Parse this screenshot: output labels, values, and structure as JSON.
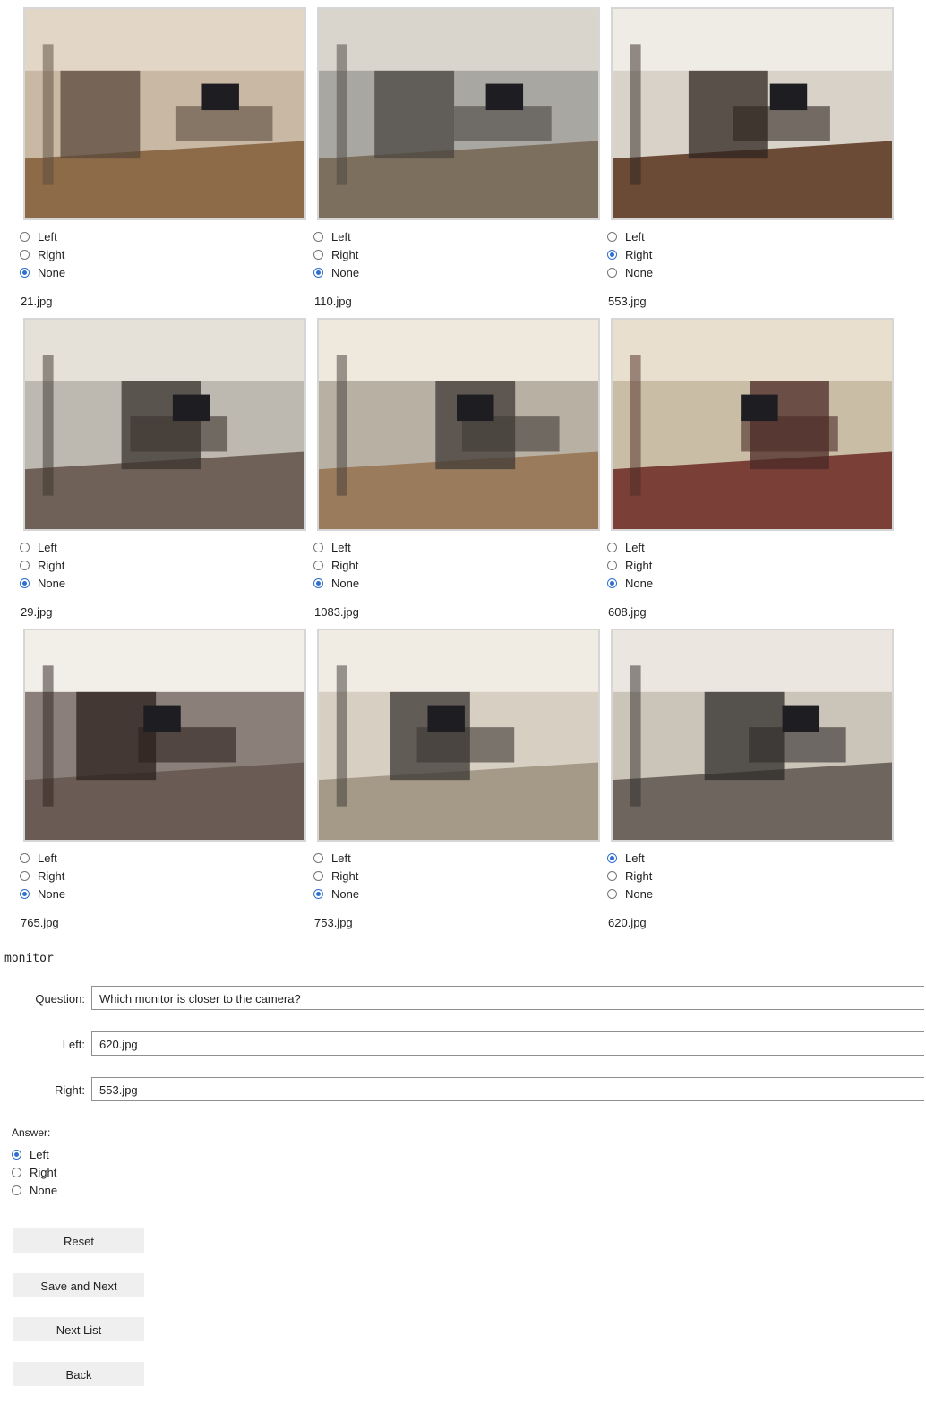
{
  "grid": [
    {
      "file": "21.jpg",
      "icon": "office-photo",
      "selected": "None",
      "options": [
        "Left",
        "Right",
        "None"
      ]
    },
    {
      "file": "110.jpg",
      "icon": "library-photo",
      "selected": "None",
      "options": [
        "Left",
        "Right",
        "None"
      ]
    },
    {
      "file": "553.jpg",
      "icon": "office-desk-photo",
      "selected": "Right",
      "options": [
        "Left",
        "Right",
        "None"
      ]
    },
    {
      "file": "29.jpg",
      "icon": "office-room-photo",
      "selected": "None",
      "options": [
        "Left",
        "Right",
        "None"
      ]
    },
    {
      "file": "1083.jpg",
      "icon": "study-room-photo",
      "selected": "None",
      "options": [
        "Left",
        "Right",
        "None"
      ]
    },
    {
      "file": "608.jpg",
      "icon": "office-chair-photo",
      "selected": "None",
      "options": [
        "Left",
        "Right",
        "None"
      ]
    },
    {
      "file": "765.jpg",
      "icon": "kitchen-photo",
      "selected": "None",
      "options": [
        "Left",
        "Right",
        "None"
      ]
    },
    {
      "file": "753.jpg",
      "icon": "kitchen-stove-photo",
      "selected": "None",
      "options": [
        "Left",
        "Right",
        "None"
      ]
    },
    {
      "file": "620.jpg",
      "icon": "office-desk-photo",
      "selected": "Left",
      "options": [
        "Left",
        "Right",
        "None"
      ]
    }
  ],
  "word": "monitor",
  "form": {
    "question_label": "Question:",
    "question": "Which monitor is closer to the camera?",
    "left_label": "Left:",
    "left": "620.jpg",
    "right_label": "Right:",
    "right": "553.jpg"
  },
  "answer": {
    "label": "Answer:",
    "options": [
      "Left",
      "Right",
      "None"
    ],
    "selected": "Left"
  },
  "buttons": {
    "reset": "Reset",
    "save_next": "Save and Next",
    "next_list": "Next List",
    "back": "Back"
  },
  "colors": {
    "accent": "#2f6fd1",
    "button_bg": "#efefef",
    "photo_border": "#d6d6d6"
  }
}
